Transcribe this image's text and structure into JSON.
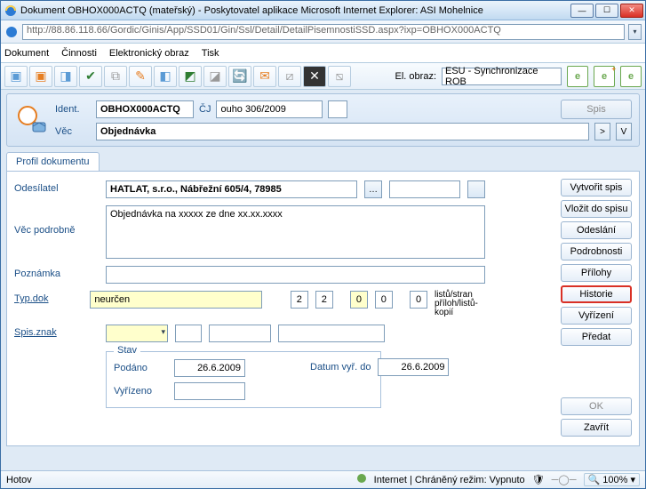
{
  "window": {
    "title": "Dokument OBHOX000ACTQ (mateřský) - Poskytovatel aplikace Microsoft Internet Explorer: ASI Mohelnice"
  },
  "address": "http://88.86.118.66/Gordic/Ginis/App/SSD01/Gin/Ssl/Detail/DetailPisemnostiSSD.aspx?ixp=OBHOX000ACTQ",
  "menu": {
    "dokument": "Dokument",
    "cinnosti": "Činnosti",
    "eobraz": "Elektronický obraz",
    "tisk": "Tisk"
  },
  "toolbar": {
    "elo_label": "El. obraz:",
    "elo_value": "ESU - Synchronizace ROB"
  },
  "header": {
    "ident_label": "Ident.",
    "ident_value": "OBHOX000ACTQ",
    "cj_label": "ČJ",
    "cj_value": "ouho 306/2009",
    "vec_label": "Věc",
    "vec_value": "Objednávka",
    "spis_btn": "Spis",
    "gt": ">",
    "vbtn": "V"
  },
  "tab": {
    "profil": "Profil dokumentu"
  },
  "form": {
    "odesilatel_label": "Odesílatel",
    "odesilatel_value": "HATLAT, s.r.o.,  Nábřežní 605/4,  78985",
    "vec_podrobne_label": "Věc podrobně",
    "vec_podrobne_value": "Objednávka na xxxxx ze dne xx.xx.xxxx",
    "poznamka_label": "Poznámka",
    "typdok_label": "Typ.dok",
    "typdok_value": "neurčen",
    "num1": "2",
    "num2": "2",
    "num3": "0",
    "num4": "0",
    "num5": "0",
    "listu_line1": "listů/stran",
    "listu_line2": "příloh/listů-kopií",
    "spisznak_label": "Spis.znak"
  },
  "stav": {
    "title": "Stav",
    "podano_label": "Podáno",
    "podano_date": "26.6.2009",
    "vyrizeno_label": "Vyřízeno",
    "datumvyr_label": "Datum vyř. do",
    "datumvyr_date": "26.6.2009"
  },
  "side": {
    "vytvorit": "Vytvořit spis",
    "vlozit": "Vložit do spisu",
    "odeslani": "Odeslání",
    "podrobnosti": "Podrobnosti",
    "prilohy": "Přílohy",
    "historie": "Historie",
    "vyrizeni": "Vyřízení",
    "predat": "Předat",
    "ok": "OK",
    "zavrit": "Zavřít"
  },
  "status": {
    "hotov": "Hotov",
    "internet": "Internet | Chráněný režim: Vypnuto",
    "zoom": "100%"
  }
}
